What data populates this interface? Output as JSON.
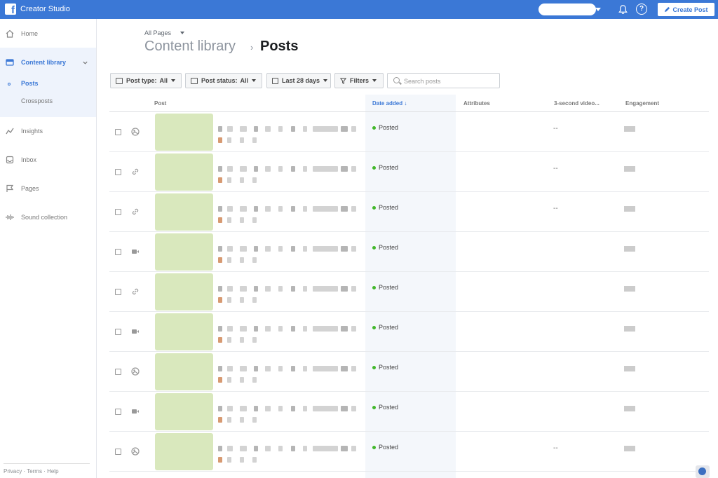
{
  "app": {
    "title": "Creator Studio",
    "create_post": "Create Post"
  },
  "sidebar": {
    "items": [
      {
        "label": "Home",
        "icon": "home-icon"
      },
      {
        "label": "Content library",
        "icon": "content-library-icon"
      },
      {
        "label": "Insights",
        "icon": "insights-icon"
      },
      {
        "label": "Inbox",
        "icon": "inbox-icon"
      },
      {
        "label": "Pages",
        "icon": "flag-icon"
      },
      {
        "label": "Sound collection",
        "icon": "sound-icon"
      }
    ],
    "sub_items": [
      {
        "label": "Posts"
      },
      {
        "label": "Crossposts"
      }
    ],
    "footer": "Privacy · Terms · Help"
  },
  "header": {
    "page_selector": "All Pages",
    "breadcrumb_parent": "Content library",
    "breadcrumb_current": "Posts"
  },
  "filters": {
    "post_type": {
      "label": "Post type:",
      "value": "All"
    },
    "post_status": {
      "label": "Post status:",
      "value": "All"
    },
    "date_range": "Last 28 days",
    "filters": "Filters",
    "search_placeholder": "Search posts"
  },
  "table": {
    "columns": [
      "Post",
      "Date added ↓",
      "Attributes",
      "3-second video...",
      "Engagement"
    ],
    "rows": [
      {
        "type": "photo",
        "status": "Posted",
        "views": "--"
      },
      {
        "type": "link",
        "status": "Posted",
        "views": "--"
      },
      {
        "type": "link",
        "status": "Posted",
        "views": "--"
      },
      {
        "type": "video",
        "status": "Posted",
        "views": ""
      },
      {
        "type": "link",
        "status": "Posted",
        "views": ""
      },
      {
        "type": "video",
        "status": "Posted",
        "views": ""
      },
      {
        "type": "photo",
        "status": "Posted",
        "views": ""
      },
      {
        "type": "video",
        "status": "Posted",
        "views": ""
      },
      {
        "type": "photo",
        "status": "Posted",
        "views": "--"
      }
    ]
  },
  "colors": {
    "brand": "#3b78d6",
    "posted": "#42b72a",
    "thumb": "#d9e8bd"
  }
}
